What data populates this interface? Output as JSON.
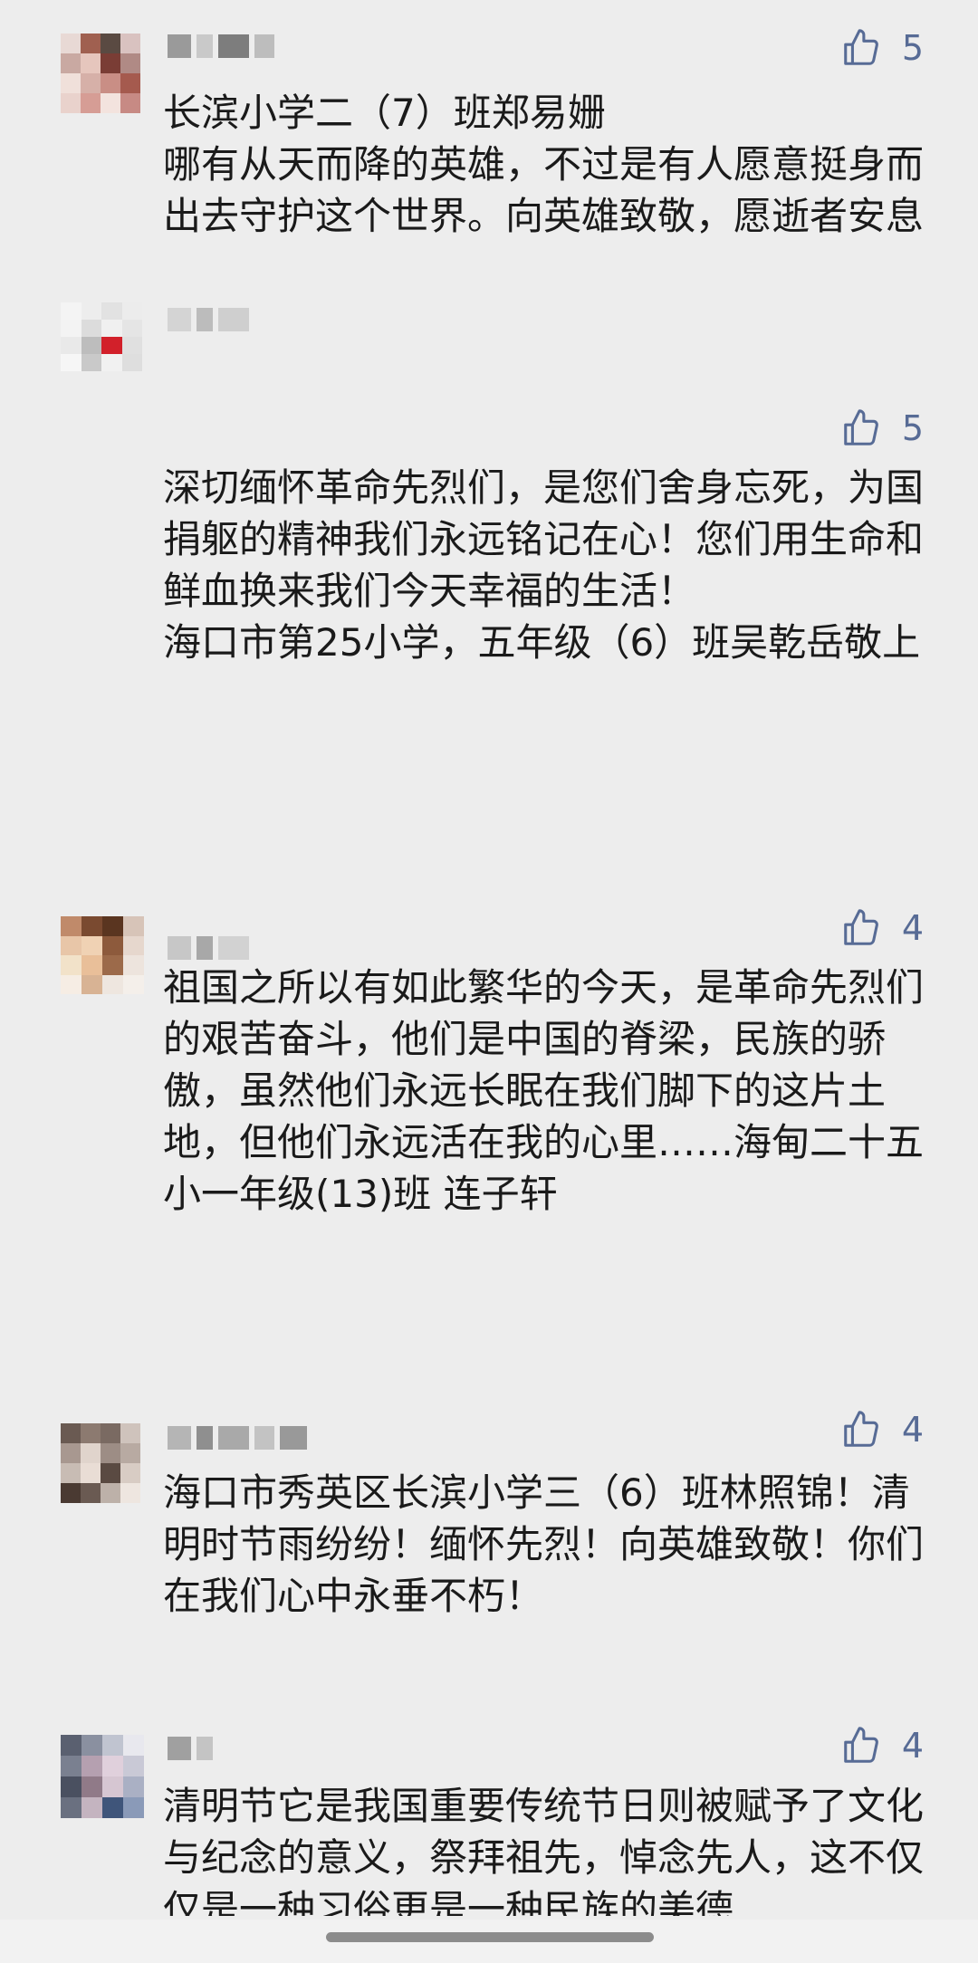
{
  "comments": [
    {
      "avatar_colors": [
        "#e8d9d5",
        "#a06050",
        "#5a4a42",
        "#d9c2c0",
        "#c9a9a2",
        "#e6c6bd",
        "#7a3d35",
        "#b08a85",
        "#f0e0da",
        "#d6b0a8",
        "#c98e85",
        "#a55a4e",
        "#e9d2cc",
        "#d69d95",
        "#f3e3de",
        "#c78a84"
      ],
      "name_blocks": [
        "#9a9a9a",
        "#c9c9c9",
        "#7d7d7d",
        "#bdbdbd"
      ],
      "likes": "5",
      "text": "长滨小学二（7）班郑易姗\n哪有从天而降的英雄，不过是有人愿意挺身而出去守护这个世界。向英雄致敬，愿逝者安息"
    },
    {
      "avatar_colors": [
        "#f4f4f4",
        "#ededed",
        "#e2e2e2",
        "#ececec",
        "#f3f3f3",
        "#dcdcdc",
        "#f0f0f0",
        "#e5e5e5",
        "#e9e9e9",
        "#bdbdbd",
        "#d2202a",
        "#e0e0e0",
        "#f6f6f6",
        "#c9c9c9",
        "#f1f1f1",
        "#dedede"
      ],
      "name_blocks": [
        "#d4d4d4",
        "#bcbcbc",
        "#cfcfcf"
      ],
      "likes": "5",
      "text": "深切缅怀革命先烈们，是您们舍身忘死，为国捐躯的精神我们永远铭记在心！您们用生命和鲜血换来我们今天幸福的生活！\n海口市第25小学，五年级（6）班吴乾岳敬上"
    },
    {
      "avatar_colors": [
        "#c08a6a",
        "#7a4a30",
        "#5a3520",
        "#d7c4b8",
        "#e8c6a8",
        "#f0d2b4",
        "#8d5a3c",
        "#e6d7cd",
        "#f2e2c9",
        "#e9bf99",
        "#9c6a4a",
        "#ede4dd",
        "#f6ede4",
        "#d8b394",
        "#eee6df",
        "#f4efea"
      ],
      "name_blocks": [
        "#c7c7c7",
        "#a8a8a8",
        "#d2d2d2"
      ],
      "likes": "4",
      "text": "祖国之所以有如此繁华的今天，是革命先烈们的艰苦奋斗，他们是中国的脊梁，民族的骄傲，虽然他们永远长眠在我们脚下的这片土地，但他们永远活在我的心里……海甸二十五小一年级(13)班 连子轩"
    },
    {
      "avatar_colors": [
        "#6a5a52",
        "#8c7a70",
        "#7a6a62",
        "#cfc3bc",
        "#a89890",
        "#e0d4cc",
        "#9d8d85",
        "#b8aaa2",
        "#c8bcb4",
        "#e9ddd5",
        "#5a4a42",
        "#d8ccc4",
        "#4a3a32",
        "#6a5a52",
        "#bdb1a9",
        "#eee6e0"
      ],
      "name_blocks": [
        "#b5b5b5",
        "#8f8f8f",
        "#a9a9a9",
        "#c3c3c3",
        "#999999"
      ],
      "likes": "4",
      "text": "海口市秀英区长滨小学三（6）班林照锦！清明时节雨纷纷！缅怀先烈！向英雄致敬！你们在我们心中永垂不朽！"
    },
    {
      "avatar_colors": [
        "#5a6070",
        "#8a90a0",
        "#c0c4d0",
        "#e8e8ee",
        "#7a8090",
        "#b5a0b0",
        "#e0d0dc",
        "#c9c9d6",
        "#4a5060",
        "#907a88",
        "#d6c6d2",
        "#aab0c4",
        "#6a7080",
        "#c4b4c0",
        "#3f557a",
        "#8a9ab8"
      ],
      "name_blocks": [
        "#a0a0a0",
        "#c4c4c4"
      ],
      "likes": "4",
      "text": "清明节它是我国重要传统节日则被赋予了文化与纪念的意义，祭拜祖先，悼念先人，这不仅仅是一种习俗更是一种民族的美德"
    }
  ],
  "icons": {
    "like": "thumbs-up-outline-icon"
  },
  "colors": {
    "link_blue": "#576b95",
    "background": "#ededed"
  }
}
